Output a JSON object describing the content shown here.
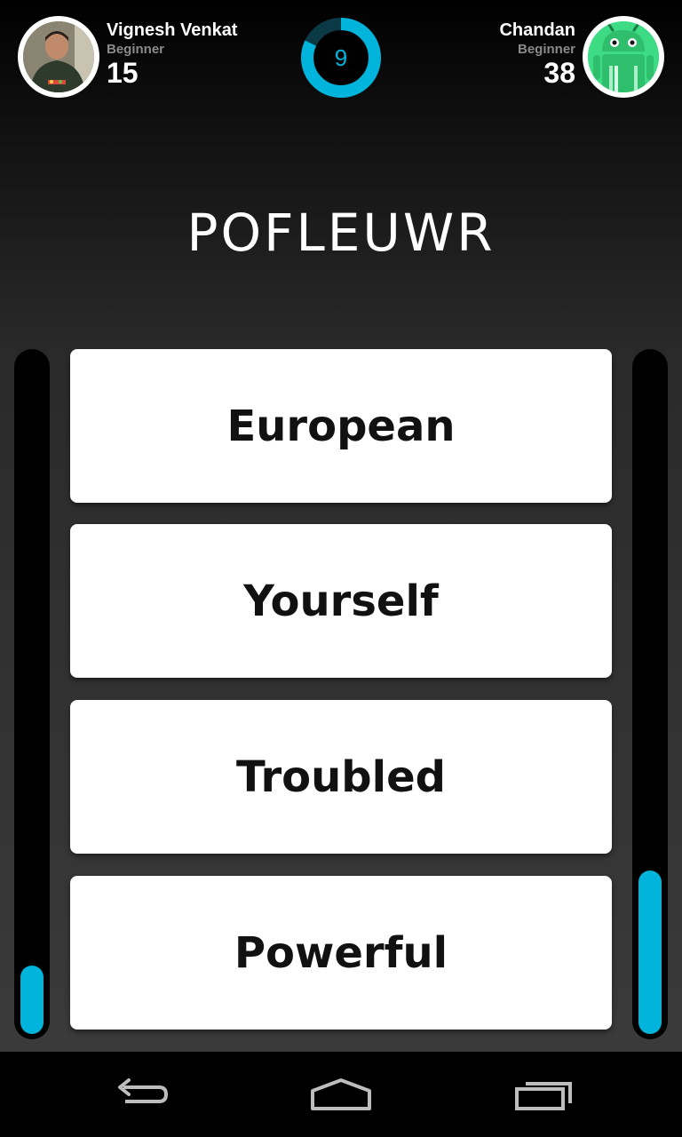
{
  "player_left": {
    "name": "Vignesh Venkat",
    "level": "Beginner",
    "score": "15",
    "progress": 0.1
  },
  "player_right": {
    "name": "Chandan",
    "level": "Beginner",
    "score": "38",
    "progress": 0.24
  },
  "timer": {
    "value": "9",
    "fraction": 0.82,
    "color": "#00b4db"
  },
  "scrambled_word": "POFLEUWR",
  "options": [
    "European",
    "Yourself",
    "Troubled",
    "Powerful"
  ],
  "nav": {
    "back": "back-icon",
    "home": "home-icon",
    "recents": "recents-icon"
  }
}
